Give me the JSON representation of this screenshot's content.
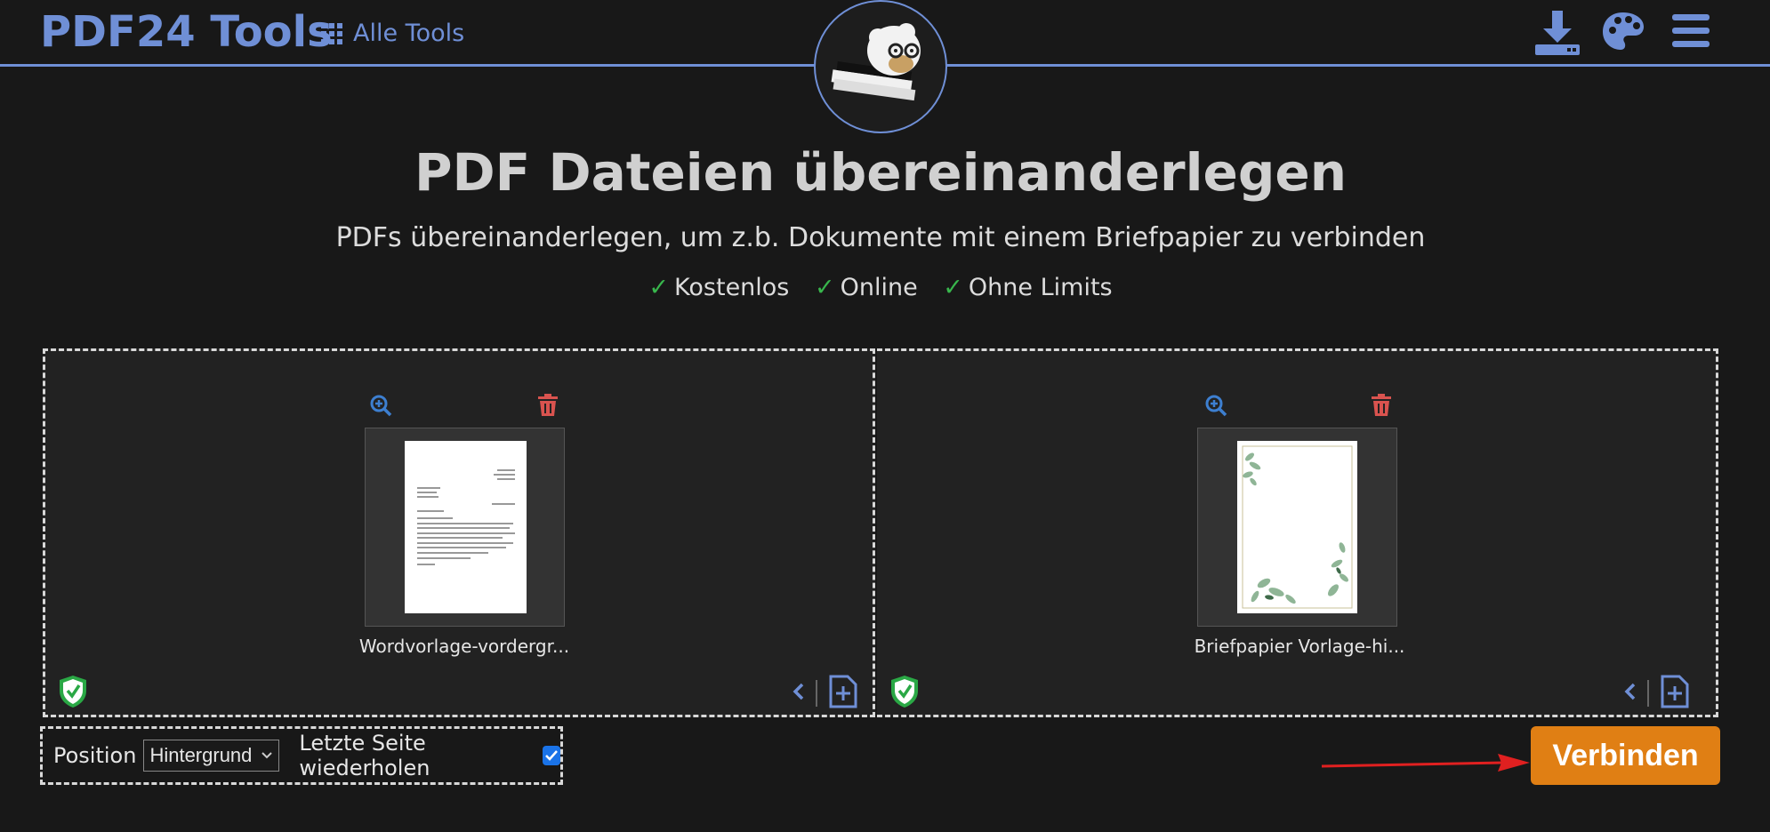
{
  "header": {
    "logo": "PDF24 Tools",
    "all_tools": "Alle Tools",
    "colors": {
      "accent": "#6f8fd6",
      "background": "#181818"
    },
    "icons": [
      "download-icon",
      "palette-icon",
      "menu-icon"
    ]
  },
  "main": {
    "title": "PDF Dateien übereinanderlegen",
    "subtitle": "PDFs übereinanderlegen, um z.b. Dokumente mit einem Briefpapier zu verbinden",
    "features": [
      {
        "check": "✓",
        "label": "Kostenlos"
      },
      {
        "check": "✓",
        "label": "Online"
      },
      {
        "check": "✓",
        "label": "Ohne Limits"
      }
    ]
  },
  "files": [
    {
      "name": "Wordvorlage-vordergr..."
    },
    {
      "name": "Briefpapier Vorlage-hi..."
    }
  ],
  "options": {
    "position_label": "Position",
    "position_value": "Hintergrund",
    "repeat_label": "Letzte Seite wiederholen",
    "repeat_checked": true
  },
  "action": {
    "label": "Verbinden",
    "color": "#e07f14"
  }
}
